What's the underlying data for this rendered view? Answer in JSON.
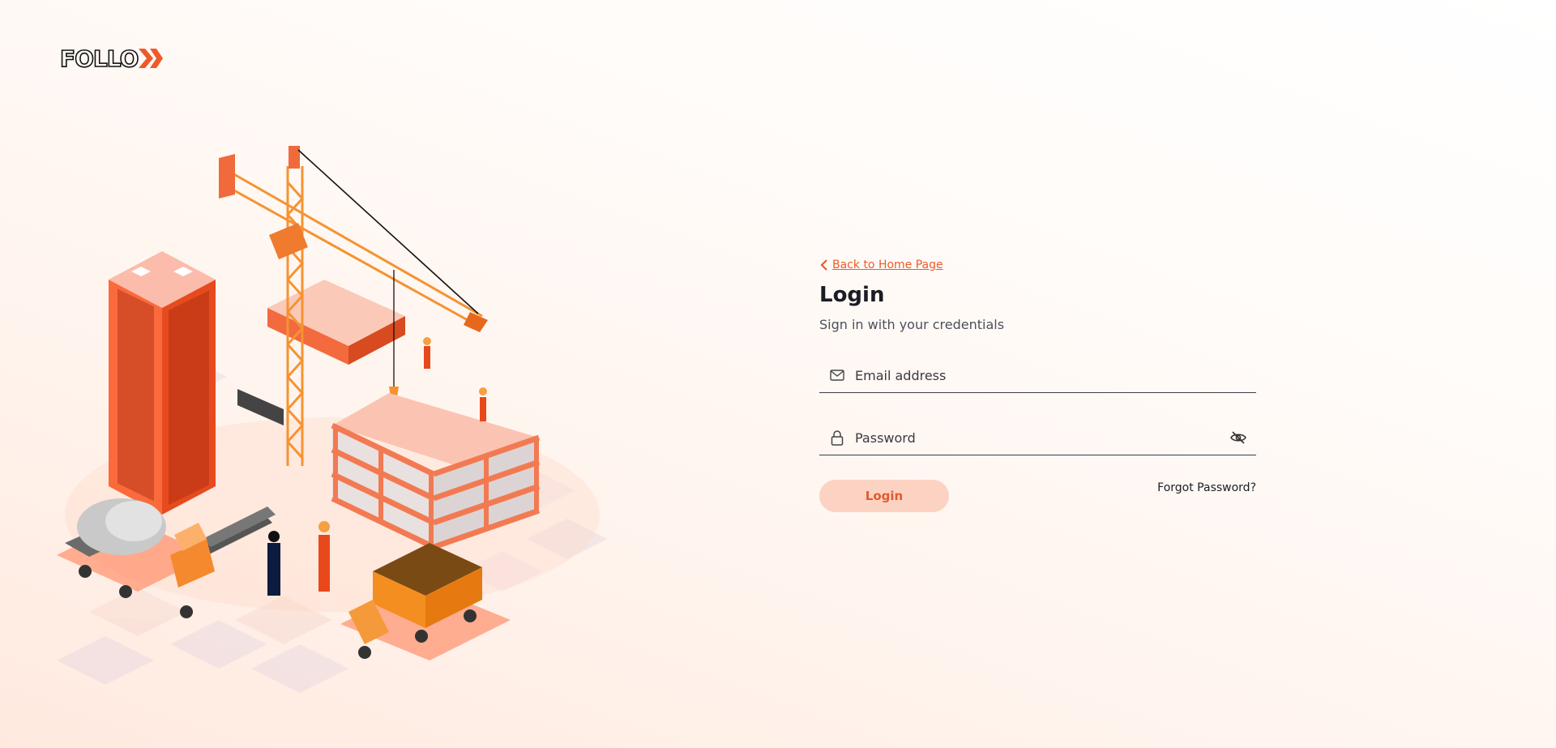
{
  "brand": {
    "name": "FOLLO",
    "accent_color": "#ee5a2a"
  },
  "login_form": {
    "back_link": "Back to Home Page",
    "title": "Login",
    "subtitle": "Sign in with your credentials",
    "email": {
      "placeholder": "Email address",
      "value": "",
      "icon": "envelope-icon"
    },
    "password": {
      "placeholder": "Password",
      "value": "",
      "icon": "lock-icon",
      "toggle_icon": "eye-slash-icon"
    },
    "login_button": "Login",
    "forgot_password": "Forgot Password?"
  },
  "colors": {
    "button_bg": "#fcd3c3",
    "button_text": "#e15a2d",
    "text_dark": "#1c1c24",
    "text_muted": "#4d4f5c"
  }
}
